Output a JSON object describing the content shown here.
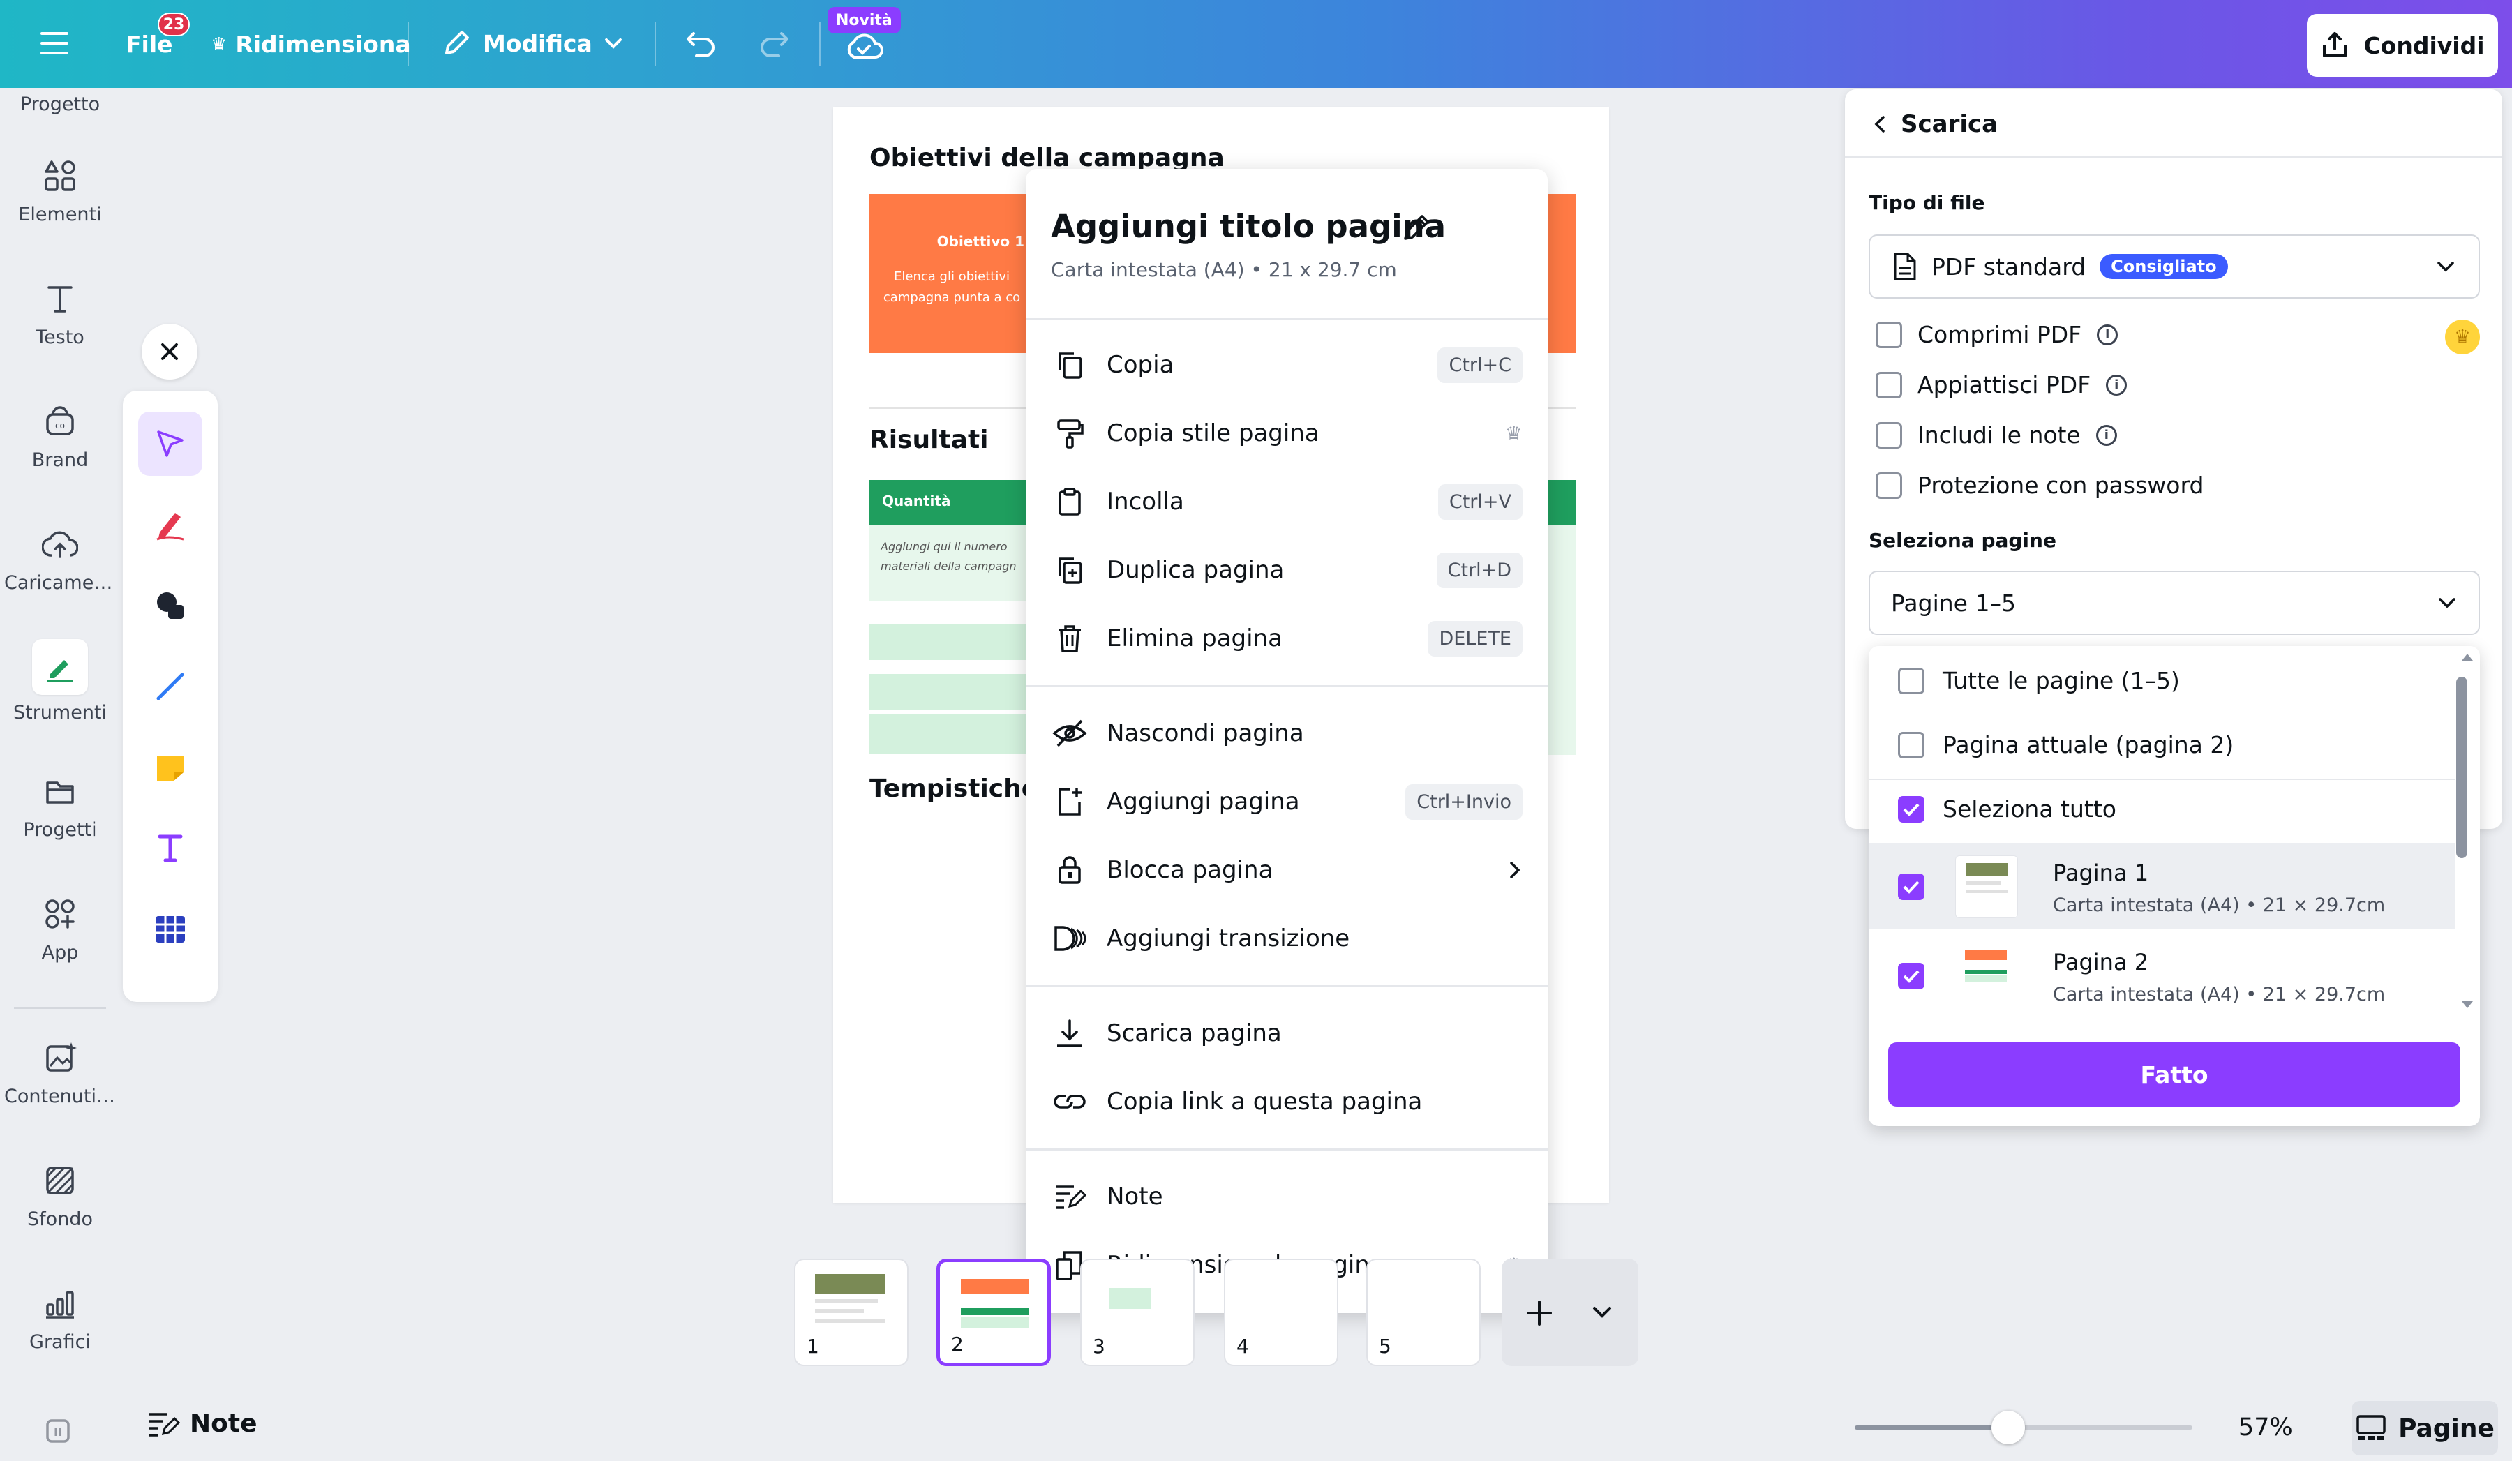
{
  "topbar": {
    "file_label": "File",
    "file_badge": "23",
    "resize_label": "Ridimensiona",
    "edit_label": "Modifica",
    "novita_label": "Novità",
    "share_label": "Condividi"
  },
  "sidebar": {
    "items": [
      {
        "label": "Progetto",
        "icon": "template-icon"
      },
      {
        "label": "Elementi",
        "icon": "elements-icon"
      },
      {
        "label": "Testo",
        "icon": "text-icon"
      },
      {
        "label": "Brand",
        "icon": "brand-icon"
      },
      {
        "label": "Caricamenti",
        "icon": "upload-icon"
      },
      {
        "label": "Strumenti",
        "icon": "tools-icon"
      },
      {
        "label": "Progetti",
        "icon": "folder-icon"
      },
      {
        "label": "App",
        "icon": "apps-icon"
      },
      {
        "label": "Contenuti ...",
        "icon": "magic-media-icon"
      },
      {
        "label": "Sfondo",
        "icon": "background-icon"
      },
      {
        "label": "Grafici",
        "icon": "charts-icon"
      }
    ]
  },
  "canvas": {
    "heading1": "Obiettivi della campagna",
    "obj_title": "Obiettivo 1",
    "obj_text": "Elenca gli obiettivi campagna punta a co",
    "heading2": "Risultati",
    "table_header": "Quantità",
    "table_text": "Aggiungi qui il numero materiali della campagn",
    "heading3": "Tempistiche"
  },
  "context_menu": {
    "title": "Aggiungi titolo pagina",
    "subtitle": "Carta intestata (A4) • 21 x 29.7 cm",
    "items": [
      {
        "label": "Copia",
        "shortcut": "Ctrl+C",
        "icon": "copy-icon"
      },
      {
        "label": "Copia stile pagina",
        "shortcut": "",
        "icon": "paint-roller-icon",
        "premium": true
      },
      {
        "label": "Incolla",
        "shortcut": "Ctrl+V",
        "icon": "paste-icon"
      },
      {
        "label": "Duplica pagina",
        "shortcut": "Ctrl+D",
        "icon": "duplicate-icon"
      },
      {
        "label": "Elimina pagina",
        "shortcut": "DELETE",
        "icon": "trash-icon"
      },
      {
        "label": "Nascondi pagina",
        "shortcut": "",
        "icon": "eye-off-icon"
      },
      {
        "label": "Aggiungi pagina",
        "shortcut": "Ctrl+Invio",
        "icon": "add-page-icon"
      },
      {
        "label": "Blocca pagina",
        "shortcut": "",
        "icon": "lock-icon"
      },
      {
        "label": "Aggiungi transizione",
        "shortcut": "",
        "icon": "transition-icon"
      },
      {
        "label": "Scarica pagina",
        "shortcut": "",
        "icon": "download-icon"
      },
      {
        "label": "Copia link a questa pagina",
        "shortcut": "",
        "icon": "link-icon"
      },
      {
        "label": "Note",
        "shortcut": "",
        "icon": "notes-icon"
      },
      {
        "label": "Ridimensiona la pagina",
        "shortcut": "",
        "icon": "resize-icon",
        "premium": true
      }
    ]
  },
  "thumbnails": [
    "1",
    "2",
    "3",
    "4",
    "5"
  ],
  "bottombar": {
    "notes_label": "Note",
    "zoom": "57%",
    "pages_label": "Pagine"
  },
  "download": {
    "title": "Scarica",
    "filetype_label": "Tipo di file",
    "filetype_value": "PDF standard",
    "filetype_badge": "Consigliato",
    "options": [
      {
        "label": "Comprimi PDF",
        "checked": false,
        "info": true
      },
      {
        "label": "Appiattisci PDF",
        "checked": false,
        "info": true
      },
      {
        "label": "Includi le note",
        "checked": false,
        "info": true
      },
      {
        "label": "Protezione con password",
        "checked": false,
        "info": false
      }
    ],
    "select_pages_label": "Seleziona pagine",
    "select_pages_value": "Pagine 1–5",
    "dropdown": {
      "all_pages": "Tutte le pagine (1–5)",
      "current_page": "Pagina attuale (pagina 2)",
      "select_all": "Seleziona tutto",
      "pages": [
        {
          "title": "Pagina 1",
          "sub": "Carta intestata (A4) • 21 × 29.7cm",
          "checked": true
        },
        {
          "title": "Pagina 2",
          "sub": "Carta intestata (A4) • 21 × 29.7cm",
          "checked": true
        }
      ]
    },
    "done_label": "Fatto"
  },
  "colors": {
    "accent": "#8b3dff",
    "topbar_start": "#1fb7c6",
    "topbar_end": "#7d4eea",
    "badge_blue": "#3b5bff",
    "orange": "#ff7a45",
    "green": "#1f9e5e"
  }
}
